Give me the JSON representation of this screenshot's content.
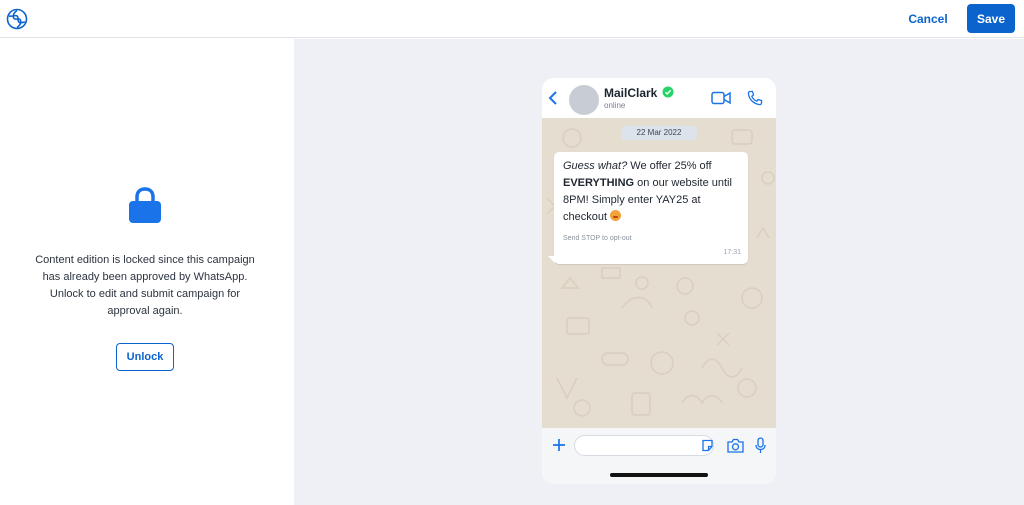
{
  "header": {
    "logo_icon": "spiral-logo-icon",
    "cancel_label": "Cancel",
    "save_label": "Save"
  },
  "left_panel": {
    "lock_icon": "lock-icon",
    "message": "Content edition is locked since this campaign has already been approved by WhatsApp. Unlock to edit and submit campaign for approval again.",
    "unlock_label": "Unlock"
  },
  "preview": {
    "contact": {
      "name": "MailClark",
      "status": "online",
      "verified_icon": "verified-check-icon"
    },
    "date_label": "22 Mar 2022",
    "message": {
      "italic_part": "Guess what?",
      "part1": " We offer 25% off ",
      "bold_part": "EVERYTHING",
      "part2": " on our website until 8PM! Simply enter YAY25 at checkout",
      "emoji_icon": "heart-eyes-emoji-icon",
      "footer": "Send STOP to opt-out",
      "time": "17:31"
    },
    "input_placeholder": ""
  },
  "colors": {
    "accent": "#0b63ce",
    "panel_bg": "#eef0f6",
    "chat_bg": "#e5ddd0",
    "verified": "#25d366"
  }
}
